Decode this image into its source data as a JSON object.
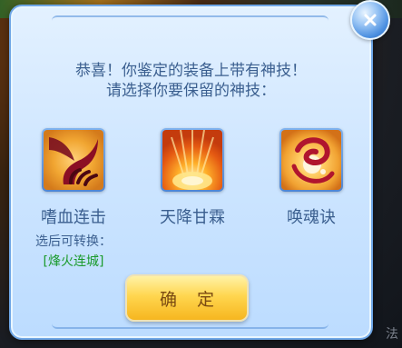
{
  "dialog": {
    "message_line1": "恭喜！你鉴定的装备上带有神技！",
    "message_line2": "请选择你要保留的神技：",
    "confirm_label": "确 定"
  },
  "skills": [
    {
      "name": "嗜血连击",
      "icon": "bloody-claw-icon",
      "transform_label": "选后可转换：",
      "transform_target": "[烽火连城]"
    },
    {
      "name": "天降甘霖",
      "icon": "heavenly-rain-icon"
    },
    {
      "name": "唤魂诀",
      "icon": "soul-summon-icon"
    }
  ],
  "background": {
    "corner_text": "法"
  },
  "colors": {
    "panel": "#cfe6ff",
    "text_blue": "#3b5f8f",
    "highlight_green": "#1a9a2b",
    "button_gold": "#ffd64f"
  }
}
